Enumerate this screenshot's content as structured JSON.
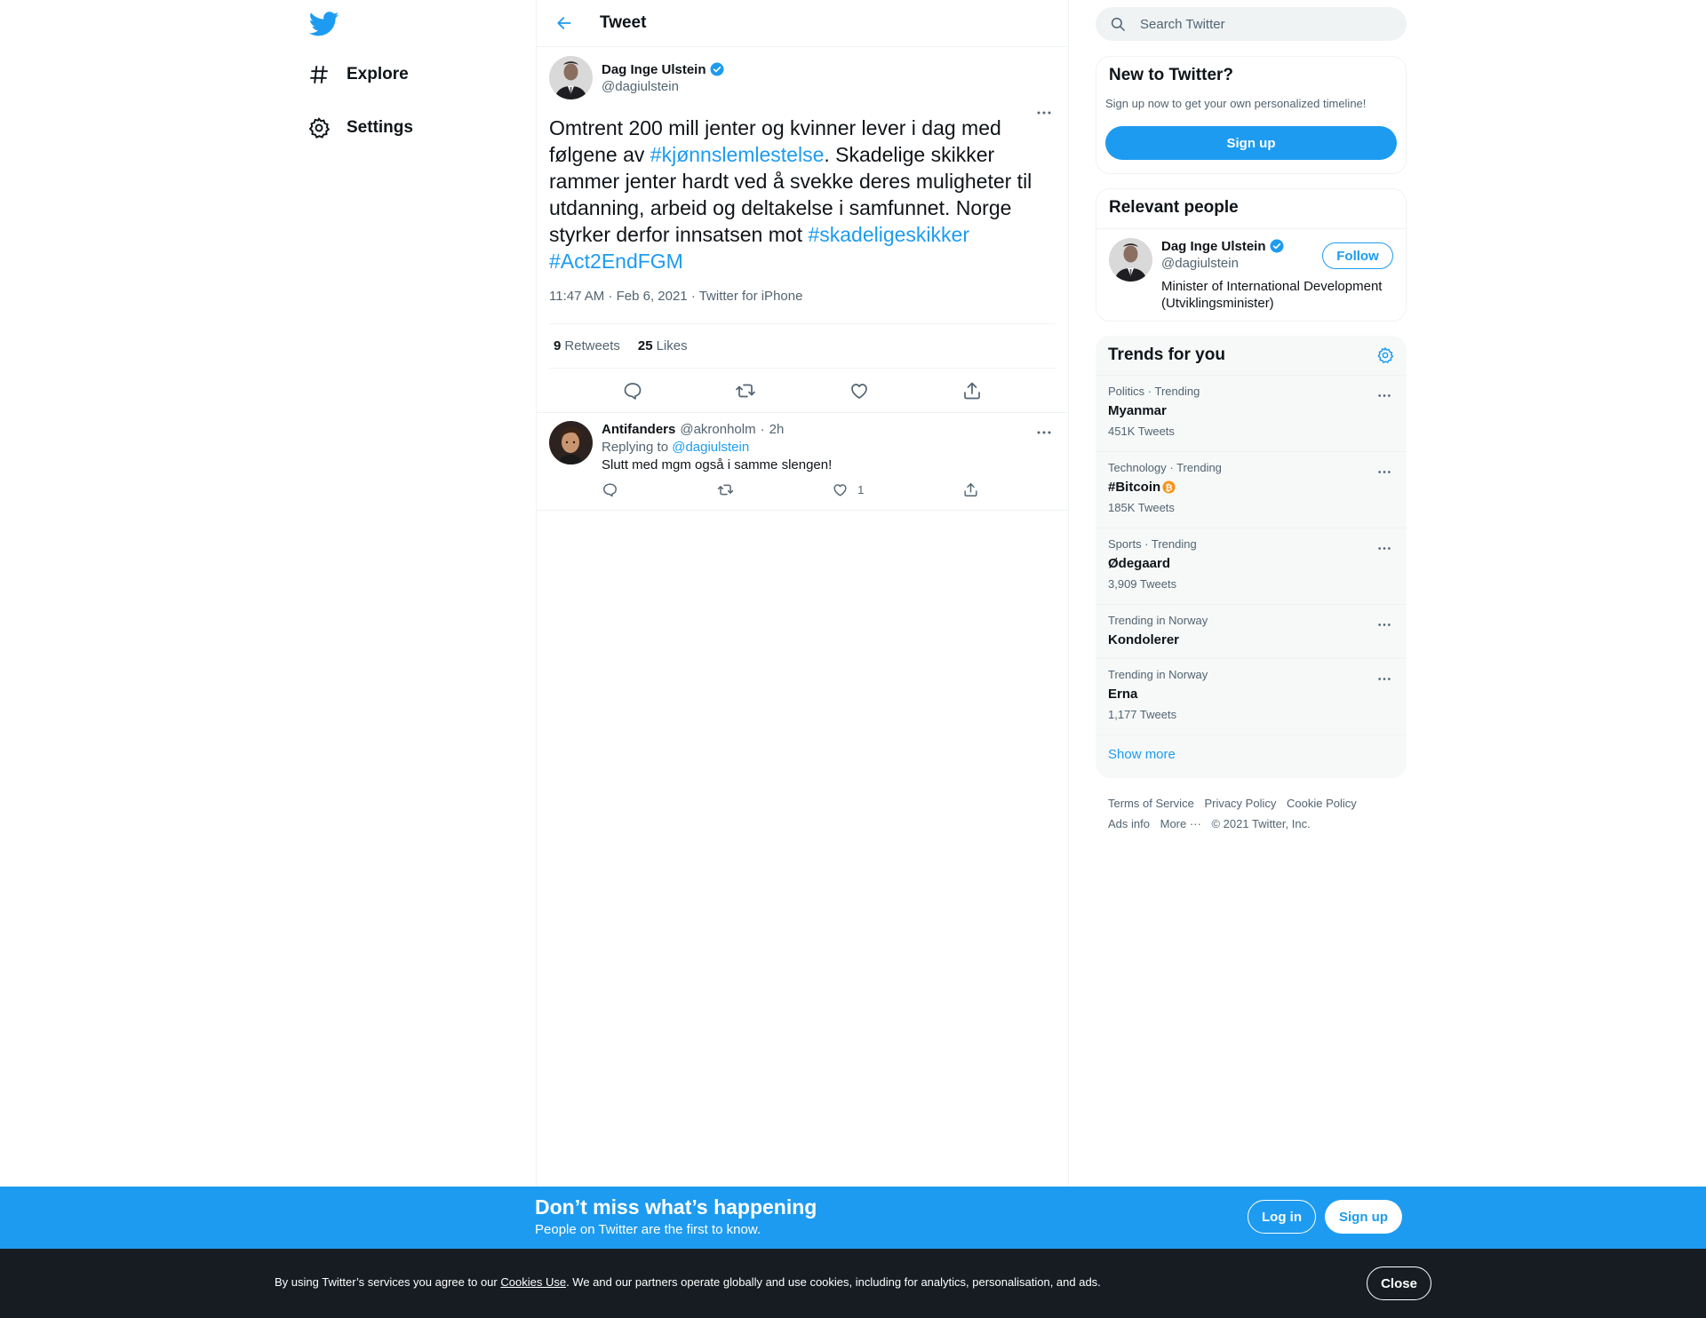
{
  "colors": {
    "accent": "#1d9bf0",
    "text": "#0f1419",
    "muted": "#536471",
    "cookie_bg": "#161c22"
  },
  "nav": {
    "logo_icon": "twitter-bird-icon",
    "items": [
      {
        "label": "Explore",
        "icon": "hashtag-icon"
      },
      {
        "label": "Settings",
        "icon": "gear-icon"
      }
    ]
  },
  "header": {
    "title": "Tweet",
    "back_icon": "arrow-left-icon"
  },
  "tweet": {
    "author_name": "Dag Inge Ulstein",
    "author_handle": "@dagiulstein",
    "text_parts": {
      "p1": "Omtrent 200 mill jenter og kvinner lever i dag med følgene av ",
      "tag1": "#kjønnslemlestelse",
      "p2": ". Skadelige skikker rammer jenter hardt ved å svekke deres muligheter til utdanning, arbeid og deltakelse i samfunnet. Norge styrker derfor innsatsen mot ",
      "tag2": "#skadeligeskikker",
      "tag3": "#Act2EndFGM"
    },
    "meta": "11:47 AM · Feb 6, 2021 · Twitter for iPhone",
    "retweets_count": "9",
    "retweets_label": "Retweets",
    "likes_count": "25",
    "likes_label": "Likes"
  },
  "reply": {
    "name": "Antifanders",
    "handle": "@akronholm",
    "dot": "·",
    "time": "2h",
    "replying_to_label": "Replying to",
    "replying_to_handle": "@dagiulstein",
    "text": "Slutt med mgm også i samme slengen!",
    "like_count": "1"
  },
  "search": {
    "placeholder": "Search Twitter"
  },
  "new_to_twitter": {
    "title": "New to Twitter?",
    "subtitle": "Sign up now to get your own personalized timeline!",
    "signup_label": "Sign up"
  },
  "relevant_people": {
    "title": "Relevant people",
    "name": "Dag Inge Ulstein",
    "handle": "@dagiulstein",
    "bio": "Minister of International Development (Utviklingsminister)",
    "follow_label": "Follow"
  },
  "trends": {
    "title": "Trends for you",
    "items": [
      {
        "category": "Politics · Trending",
        "name": "Myanmar",
        "count": "451K Tweets"
      },
      {
        "category": "Technology · Trending",
        "name": "#Bitcoin",
        "count": "185K Tweets"
      },
      {
        "category": "Sports · Trending",
        "name": "Ødegaard",
        "count": "3,909 Tweets"
      },
      {
        "category": "Trending in Norway",
        "name": "Kondolerer",
        "count": ""
      },
      {
        "category": "Trending in Norway",
        "name": "Erna",
        "count": "1,177 Tweets"
      }
    ],
    "show_more": "Show more"
  },
  "footer": {
    "links": [
      "Terms of Service",
      "Privacy Policy",
      "Cookie Policy",
      "Ads info",
      "More ···",
      "© 2021 Twitter, Inc."
    ]
  },
  "banner": {
    "title": "Don’t miss what’s happening",
    "subtitle": "People on Twitter are the first to know.",
    "login_label": "Log in",
    "signup_label": "Sign up"
  },
  "cookie": {
    "text_before": "By using Twitter’s services you agree to our ",
    "link": "Cookies Use",
    "text_after": ". We and our partners operate globally and use cookies, including for analytics, personalisation, and ads.",
    "close_label": "Close"
  }
}
